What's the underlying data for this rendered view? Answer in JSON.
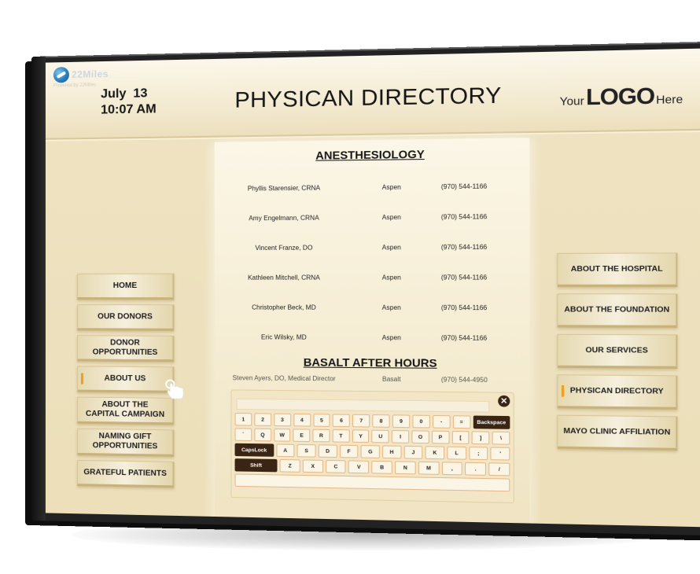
{
  "brand": {
    "name": "22Miles",
    "tagline": "Powered by 22Miles"
  },
  "header": {
    "date": "July  13",
    "time": "10:07 AM",
    "title": "PHYSICAN DIRECTORY",
    "logo": {
      "prefix": "Your",
      "main": "LOGO",
      "suffix": "Here"
    }
  },
  "directory": {
    "sections": [
      {
        "title": "ANESTHESIOLOGY",
        "rows": [
          {
            "name": "Phyllis Starensier, CRNA",
            "location": "Aspen",
            "phone": "(970) 544-1166"
          },
          {
            "name": "Amy Engelmann, CRNA",
            "location": "Aspen",
            "phone": "(970) 544-1166"
          },
          {
            "name": "Vincent Franze, DO",
            "location": "Aspen",
            "phone": "(970) 544-1166"
          },
          {
            "name": "Kathleen Mitchell, CRNA",
            "location": "Aspen",
            "phone": "(970) 544-1166"
          },
          {
            "name": "Christopher Beck, MD",
            "location": "Aspen",
            "phone": "(970) 544-1166"
          },
          {
            "name": "Eric Wilsky, MD",
            "location": "Aspen",
            "phone": "(970) 544-1166"
          }
        ]
      },
      {
        "title": "BASALT AFTER HOURS",
        "rows": [
          {
            "name": "Steven Ayers, DO, Medical Director",
            "location": "Basalt",
            "phone": "(970) 544-4950"
          }
        ]
      }
    ]
  },
  "nav_left": [
    {
      "label": "HOME",
      "active": false
    },
    {
      "label": "OUR DONORS",
      "active": false
    },
    {
      "label": "DONOR OPPORTUNITIES",
      "active": false
    },
    {
      "label": "ABOUT US",
      "active": true
    },
    {
      "label": "ABOUT THE CAPITAL CAMPAIGN",
      "active": false
    },
    {
      "label": "NAMING GIFT OPPORTUNITIES",
      "active": false
    },
    {
      "label": "GRATEFUL PATIENTS",
      "active": false
    }
  ],
  "nav_right": [
    {
      "label": "ABOUT THE HOSPITAL",
      "active": false
    },
    {
      "label": "ABOUT THE FOUNDATION",
      "active": false
    },
    {
      "label": "OUR SERVICES",
      "active": false
    },
    {
      "label": "PHYSICAN DIRECTORY",
      "active": true
    },
    {
      "label": "MAYO CLINIC AFFILIATION",
      "active": false
    }
  ],
  "keyboard": {
    "input_value": "",
    "close_icon": "close-icon",
    "rows": [
      [
        "1",
        "2",
        "3",
        "4",
        "5",
        "6",
        "7",
        "8",
        "9",
        "0",
        "-",
        "=",
        "Backspace"
      ],
      [
        "`",
        "Q",
        "W",
        "E",
        "R",
        "T",
        "Y",
        "U",
        "I",
        "O",
        "P",
        "[",
        "]",
        "\\"
      ],
      [
        "CapsLock",
        "A",
        "S",
        "D",
        "F",
        "G",
        "H",
        "J",
        "K",
        "L",
        ";",
        "'"
      ],
      [
        "Shift",
        "Z",
        "X",
        "C",
        "V",
        "B",
        "N",
        "M",
        ",",
        ".",
        "/"
      ]
    ],
    "special_keys": [
      "Backspace",
      "CapsLock",
      "Shift"
    ]
  },
  "colors": {
    "accent_marker": "#f0a020",
    "key_dark": "#3a2414",
    "key_border": "#e4b98a",
    "background": "#efe3c2"
  }
}
